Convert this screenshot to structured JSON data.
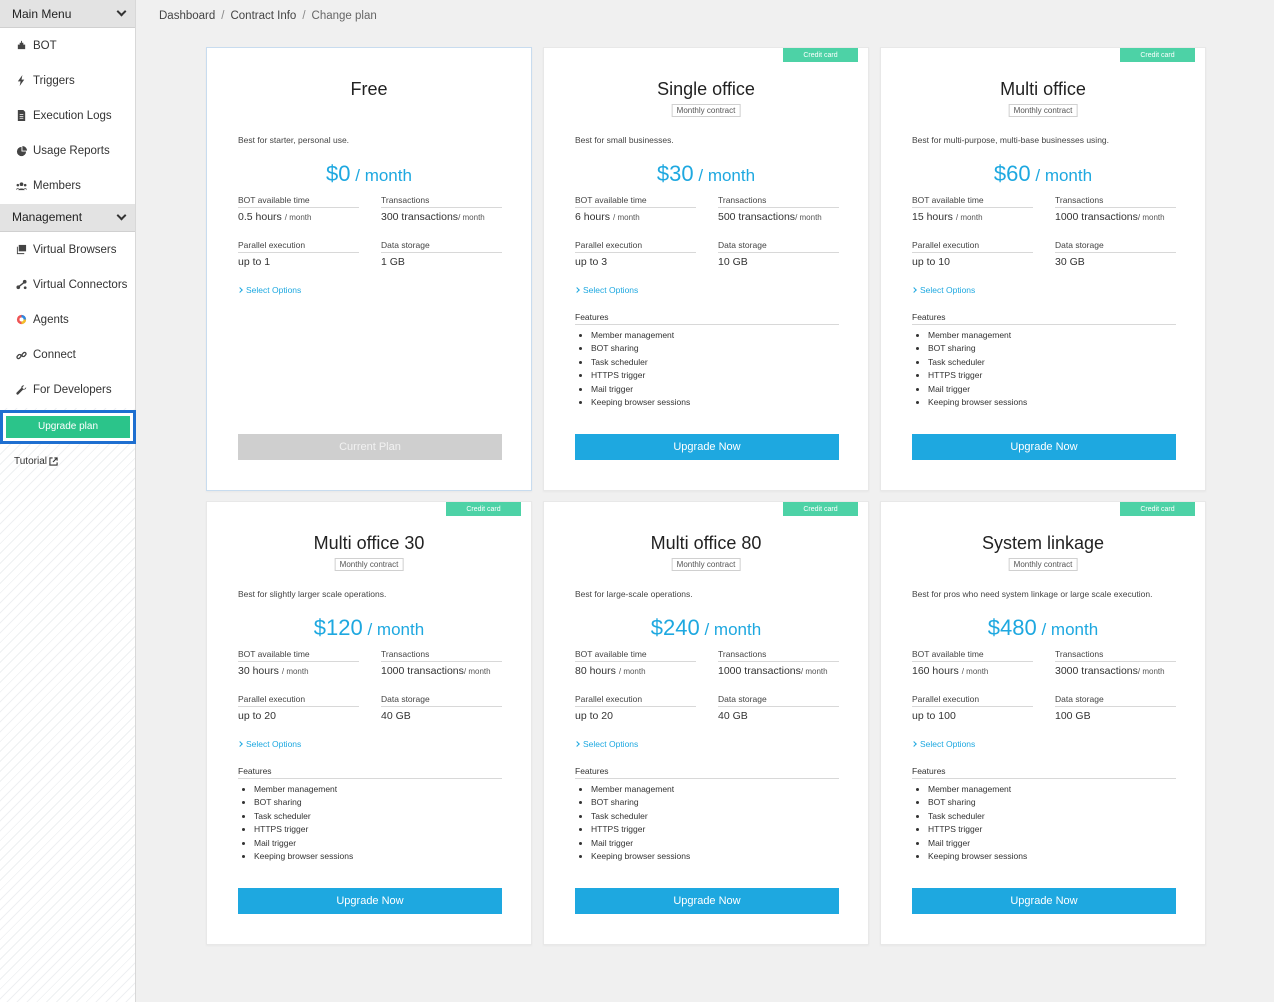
{
  "sidebar": {
    "main_menu_label": "Main Menu",
    "main_items": [
      {
        "label": "BOT",
        "icon": "robot-icon"
      },
      {
        "label": "Triggers",
        "icon": "bolt-icon"
      },
      {
        "label": "Execution Logs",
        "icon": "document-icon"
      },
      {
        "label": "Usage Reports",
        "icon": "pie-chart-icon"
      },
      {
        "label": "Members",
        "icon": "users-icon"
      }
    ],
    "management_label": "Management",
    "management_items": [
      {
        "label": "Virtual Browsers",
        "icon": "browser-icon"
      },
      {
        "label": "Virtual Connectors",
        "icon": "connector-icon"
      },
      {
        "label": "Agents",
        "icon": "agent-icon"
      },
      {
        "label": "Connect",
        "icon": "link-icon"
      },
      {
        "label": "For Developers",
        "icon": "wrench-icon"
      }
    ],
    "upgrade_label": "Upgrade plan",
    "tutorial_label": "Tutorial"
  },
  "breadcrumb": {
    "items": [
      "Dashboard",
      "Contract Info"
    ],
    "current": "Change plan"
  },
  "labels": {
    "bot_time": "BOT available time",
    "transactions": "Transactions",
    "parallel": "Parallel execution",
    "storage": "Data storage",
    "select_options": "Select Options",
    "features": "Features",
    "per_month": "/ month"
  },
  "plans": [
    {
      "name": "Free",
      "badge": "",
      "contract": "",
      "description": "Best for starter, personal use.",
      "price": "$0",
      "bot_time": "0.5 hours",
      "bot_unit": "/ month",
      "transactions": "300 transactions",
      "trans_unit": "/ month",
      "parallel": "up to 1",
      "storage": "1 GB",
      "features": [],
      "button": "Current Plan",
      "current": true
    },
    {
      "name": "Single office",
      "badge": "Credit card",
      "contract": "Monthly contract",
      "description": "Best for small businesses.",
      "price": "$30",
      "bot_time": "6 hours",
      "bot_unit": "/ month",
      "transactions": "500 transactions",
      "trans_unit": "/ month",
      "parallel": "up to 3",
      "storage": "10 GB",
      "features": [
        "Member management",
        "BOT sharing",
        "Task scheduler",
        "HTTPS trigger",
        "Mail trigger",
        "Keeping browser sessions"
      ],
      "button": "Upgrade Now",
      "current": false
    },
    {
      "name": "Multi office",
      "badge": "Credit card",
      "contract": "Monthly contract",
      "description": "Best for multi-purpose, multi-base businesses using.",
      "price": "$60",
      "bot_time": "15 hours",
      "bot_unit": "/ month",
      "transactions": "1000 transactions",
      "trans_unit": "/ month",
      "parallel": "up to 10",
      "storage": "30 GB",
      "features": [
        "Member management",
        "BOT sharing",
        "Task scheduler",
        "HTTPS trigger",
        "Mail trigger",
        "Keeping browser sessions"
      ],
      "button": "Upgrade Now",
      "current": false
    },
    {
      "name": "Multi office 30",
      "badge": "Credit card",
      "contract": "Monthly contract",
      "description": "Best for slightly larger scale operations.",
      "price": "$120",
      "bot_time": "30 hours",
      "bot_unit": "/ month",
      "transactions": "1000 transactions",
      "trans_unit": "/ month",
      "parallel": "up to 20",
      "storage": "40 GB",
      "features": [
        "Member management",
        "BOT sharing",
        "Task scheduler",
        "HTTPS trigger",
        "Mail trigger",
        "Keeping browser sessions"
      ],
      "button": "Upgrade Now",
      "current": false
    },
    {
      "name": "Multi office 80",
      "badge": "Credit card",
      "contract": "Monthly contract",
      "description": "Best for large-scale operations.",
      "price": "$240",
      "bot_time": "80 hours",
      "bot_unit": "/ month",
      "transactions": "1000 transactions",
      "trans_unit": "/ month",
      "parallel": "up to 20",
      "storage": "40 GB",
      "features": [
        "Member management",
        "BOT sharing",
        "Task scheduler",
        "HTTPS trigger",
        "Mail trigger",
        "Keeping browser sessions"
      ],
      "button": "Upgrade Now",
      "current": false
    },
    {
      "name": "System linkage",
      "badge": "Credit card",
      "contract": "Monthly contract",
      "description": "Best for pros who need system linkage or large scale execution.",
      "price": "$480",
      "bot_time": "160 hours",
      "bot_unit": "/ month",
      "transactions": "3000 transactions",
      "trans_unit": "/ month",
      "parallel": "up to 100",
      "storage": "100 GB",
      "features": [
        "Member management",
        "BOT sharing",
        "Task scheduler",
        "HTTPS trigger",
        "Mail trigger",
        "Keeping browser sessions"
      ],
      "button": "Upgrade Now",
      "current": false
    }
  ],
  "colors": {
    "accent": "#1ea8e0",
    "badge": "#4dd2a6",
    "upgrade_sidebar": "#2bc48a",
    "highlight_border": "#1e6fd0",
    "disabled": "#cfcfcf"
  }
}
